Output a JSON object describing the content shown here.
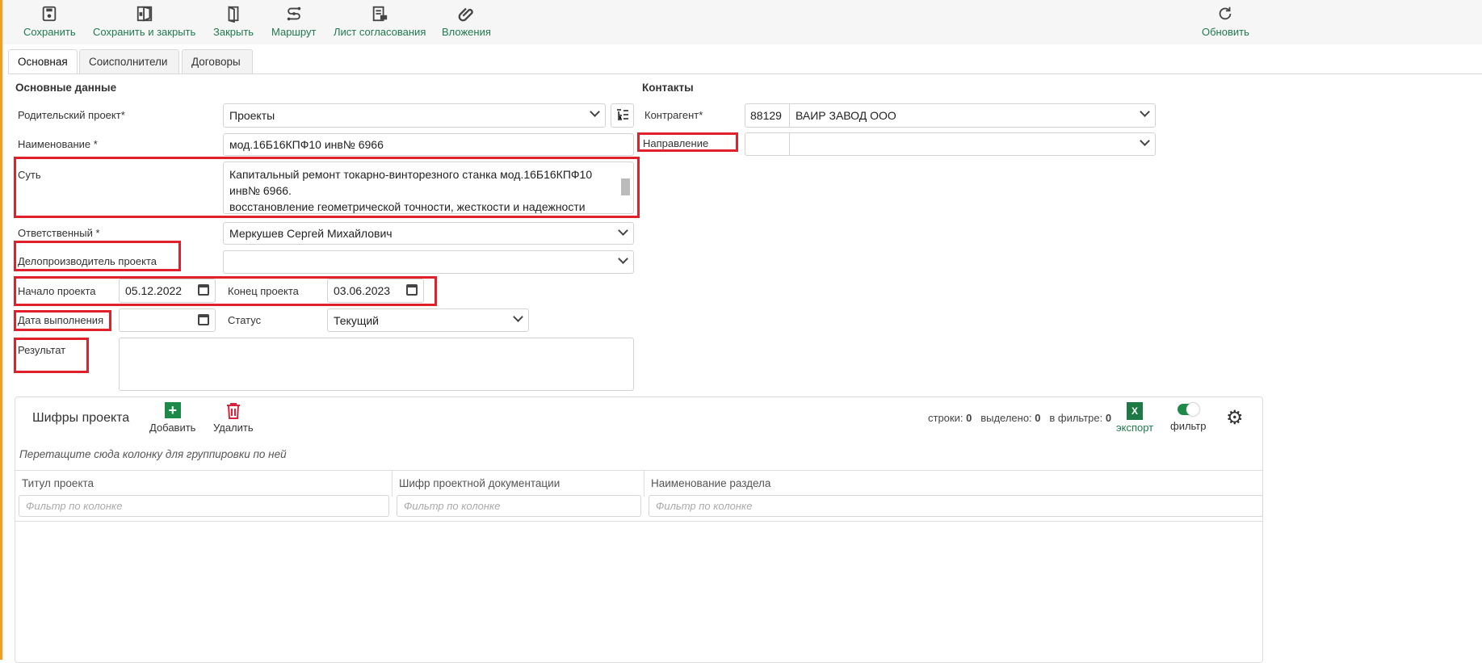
{
  "toolbar": {
    "save": "Сохранить",
    "save_close": "Сохранить и закрыть",
    "close": "Закрыть",
    "route": "Маршрут",
    "approval_sheet": "Лист согласования",
    "attachments": "Вложения",
    "refresh": "Обновить"
  },
  "tabs": [
    "Основная",
    "Соисполнители",
    "Договоры"
  ],
  "main": {
    "section_title": "Основные данные",
    "parent_label": "Родительский проект*",
    "parent_value": "Проекты",
    "name_label": "Наименование *",
    "name_value": "мод.16Б16КПФ10 инв№ 6966",
    "essence_label": "Суть",
    "essence_lines": [
      "Капитальный ремонт токарно-винторезного станка мод.16Б16КПФ10",
      "инв№ 6966.",
      "восстановление геометрической точности, жесткости и надежности"
    ],
    "responsible_label": "Ответственный *",
    "responsible_value": "Меркушев Сергей Михайлович",
    "clerk_label": "Делопроизводитель проекта",
    "clerk_value": "",
    "start_label": "Начало проекта",
    "start_value": "05.12.2022",
    "end_label": "Конец проекта",
    "end_value": "03.06.2023",
    "done_label": "Дата выполнения",
    "done_value": "",
    "status_label": "Статус",
    "status_value": "Текущий",
    "result_label": "Результат",
    "result_value": ""
  },
  "contacts": {
    "title": "Контакты",
    "counterparty_label": "Контрагент*",
    "counterparty_code": "88129",
    "counterparty_name": "ВАИР ЗАВОД ООО",
    "direction_label": "Направление"
  },
  "grid": {
    "title": "Шифры проекта",
    "add": "Добавить",
    "delete": "Удалить",
    "rows_label": "строки:",
    "rows": "0",
    "selected_label": "выделено:",
    "selected": "0",
    "filtered_label": "в фильтре:",
    "filtered": "0",
    "export": "экспорт",
    "filter": "фильтр",
    "filter_on": true,
    "group_hint": "Перетащите сюда колонку для группировки по ней",
    "columns": [
      "Титул проекта",
      "Шифр проектной документации",
      "Наименование раздела"
    ],
    "filter_placeholder": "Фильтр по колонке"
  },
  "colors": {
    "accent": "#1f7a4d",
    "highlight": "#e0202a",
    "excel": "#1d7a45",
    "delete": "#d9233a"
  }
}
